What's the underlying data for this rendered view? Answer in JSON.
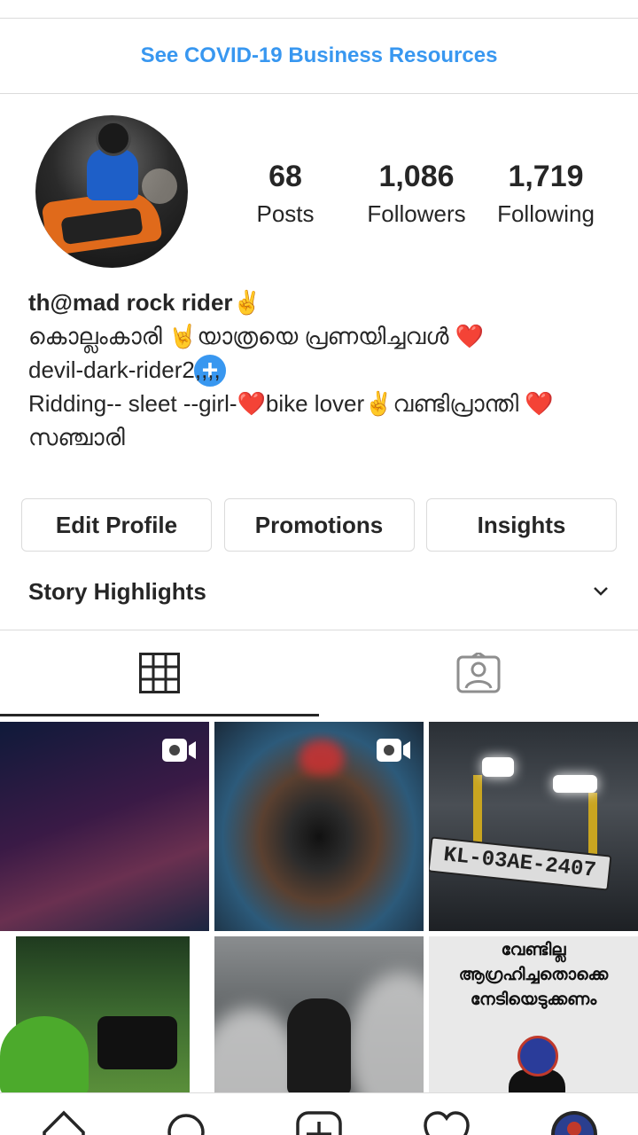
{
  "banner": {
    "covid_link": "See COVID-19 Business Resources"
  },
  "profile": {
    "stats": [
      {
        "value": "68",
        "label": "Posts"
      },
      {
        "value": "1,086",
        "label": "Followers"
      },
      {
        "value": "1,719",
        "label": "Following"
      }
    ],
    "name": "th@mad rock rider✌️",
    "bio_lines": [
      "കൊല്ലംകാരി 🤘യാത്രയെ പ്രണയിച്ചവൾ ❤️",
      "devil-dark-rider2,,,,",
      "Ridding-- sleet --girl-❤️bike lover✌️വണ്ടിപ്രാന്തി ❤️",
      "സഞ്ചാരി"
    ]
  },
  "actions": {
    "edit_profile": "Edit Profile",
    "promotions": "Promotions",
    "insights": "Insights"
  },
  "highlights": {
    "title": "Story Highlights"
  },
  "grid": {
    "posts": [
      {
        "type": "video"
      },
      {
        "type": "video"
      },
      {
        "type": "photo",
        "plate_text": "KL-03AE-2407"
      },
      {
        "type": "photo"
      },
      {
        "type": "photo"
      },
      {
        "type": "photo",
        "text_lines": [
          "വേണ്ടില്ല",
          "ആഗ്രഹിച്ചതൊക്കെ",
          "നേടിയെടുക്കണം"
        ]
      }
    ]
  },
  "icons": {
    "add_story": "plus-icon",
    "grid_tab": "grid-icon",
    "tagged_tab": "tagged-person-icon",
    "video_badge": "video-camera-icon",
    "chevron": "chevron-down-icon",
    "nav": [
      "home-icon",
      "search-icon",
      "add-post-icon",
      "heart-icon",
      "profile-avatar"
    ]
  },
  "colors": {
    "link": "#3897f0",
    "text": "#262626",
    "border": "#dbdbdb"
  }
}
